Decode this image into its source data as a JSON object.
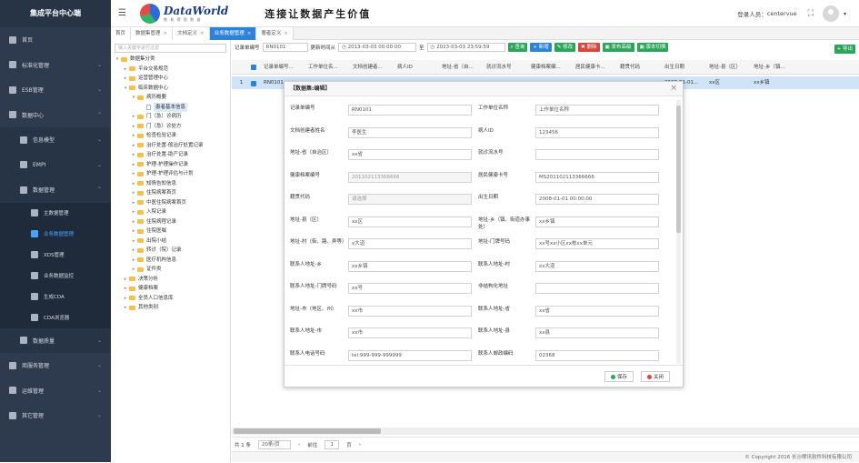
{
  "sidebar": {
    "brand": "集成平台中心端",
    "items": [
      {
        "label": "首页"
      },
      {
        "label": "标准化管理"
      },
      {
        "label": "ESB管理"
      },
      {
        "label": "数据中心"
      },
      {
        "label": "信息模型"
      },
      {
        "label": "EMPI"
      },
      {
        "label": "数据管理"
      },
      {
        "label": "主数据管理"
      },
      {
        "label": "业务数据管理"
      },
      {
        "label": "XDS管理"
      },
      {
        "label": "业务数据监控"
      },
      {
        "label": "生成CDA"
      },
      {
        "label": "CDA浏览器"
      },
      {
        "label": "数据质量"
      },
      {
        "label": "商服务管理"
      },
      {
        "label": "运维管理"
      },
      {
        "label": "其它管理"
      }
    ]
  },
  "header": {
    "logo_text": "DataWorld",
    "logo_sub": "数 易 得 智 数 据",
    "slogan": "连接让数据产生价值",
    "login_label": "登录人员：",
    "user": "centervue"
  },
  "tabs": [
    {
      "label": "首页"
    },
    {
      "label": "数据集管理"
    },
    {
      "label": "文档定义"
    },
    {
      "label": "业务数据管理"
    },
    {
      "label": "著者定义"
    }
  ],
  "tree": {
    "search_placeholder": "输入关键字进行过滤",
    "nodes": [
      {
        "label": "数据集分类",
        "level": 0,
        "toggle": "▾",
        "type": "folder"
      },
      {
        "label": "平台交易规范",
        "level": 1,
        "toggle": "▸",
        "type": "folder"
      },
      {
        "label": "运营管理中心",
        "level": 1,
        "toggle": "▸",
        "type": "folder"
      },
      {
        "label": "临床数据中心",
        "level": 1,
        "toggle": "▾",
        "type": "folder"
      },
      {
        "label": "病历概要",
        "level": 2,
        "toggle": "▾",
        "type": "folder"
      },
      {
        "label": "患者基本信息",
        "level": 3,
        "toggle": "",
        "type": "file"
      },
      {
        "label": "门（急）诊病历",
        "level": 2,
        "toggle": "▸",
        "type": "folder"
      },
      {
        "label": "门（急）诊处方",
        "level": 2,
        "toggle": "▸",
        "type": "folder"
      },
      {
        "label": "检查检验记录",
        "level": 2,
        "toggle": "▸",
        "type": "folder"
      },
      {
        "label": "治疗处置-般治疗处置记录",
        "level": 2,
        "toggle": "▸",
        "type": "folder"
      },
      {
        "label": "治疗处置-助产记录",
        "level": 2,
        "toggle": "▸",
        "type": "folder"
      },
      {
        "label": "护理-护理操作记录",
        "level": 2,
        "toggle": "▸",
        "type": "folder"
      },
      {
        "label": "护理-护理评估与计划",
        "level": 2,
        "toggle": "▸",
        "type": "folder"
      },
      {
        "label": "知情告知信息",
        "level": 2,
        "toggle": "▸",
        "type": "folder"
      },
      {
        "label": "住院病案首页",
        "level": 2,
        "toggle": "▸",
        "type": "folder"
      },
      {
        "label": "中医住院病案首页",
        "level": 2,
        "toggle": "▸",
        "type": "folder"
      },
      {
        "label": "入院记录",
        "level": 2,
        "toggle": "▸",
        "type": "folder"
      },
      {
        "label": "住院病程记录",
        "level": 2,
        "toggle": "▸",
        "type": "folder"
      },
      {
        "label": "住院医嘱",
        "level": 2,
        "toggle": "▸",
        "type": "folder"
      },
      {
        "label": "出院小结",
        "level": 2,
        "toggle": "▸",
        "type": "folder"
      },
      {
        "label": "转诊（院）记录",
        "level": 2,
        "toggle": "▸",
        "type": "folder"
      },
      {
        "label": "医疗机构信息",
        "level": 2,
        "toggle": "▸",
        "type": "folder"
      },
      {
        "label": "证件类",
        "level": 2,
        "toggle": "▸",
        "type": "folder"
      },
      {
        "label": "决策分析",
        "level": 1,
        "toggle": "▸",
        "type": "folder"
      },
      {
        "label": "健康档案",
        "level": 1,
        "toggle": "▸",
        "type": "folder"
      },
      {
        "label": "全员人口信息库",
        "level": 1,
        "toggle": "▸",
        "type": "folder"
      },
      {
        "label": "其他类别",
        "level": 1,
        "toggle": "▸",
        "type": "folder"
      }
    ]
  },
  "toolbar": {
    "record_label": "记录单编号",
    "record_value": "RN0101",
    "time_label": "更新时间从",
    "date_from": "2013-03-03 00:00:00",
    "to_label": "至",
    "date_to": "2023-03-03 23:59:59",
    "query": "查询",
    "add": "新增",
    "edit": "修改",
    "delete": "删除",
    "publish": "发布高级",
    "version": "版本切换",
    "export": "导出"
  },
  "grid": {
    "headers": [
      "记录单编号...",
      "工作单位名...",
      "文档创建者...",
      "病人ID",
      "地址-省（自...",
      "就诊流水号",
      "健康档案编...",
      "居民健康卡...",
      "籍贯代码",
      "出生日期",
      "地址-县（区）",
      "地址-乡（镇..."
    ],
    "row": {
      "num": "1",
      "cells": [
        "RN0101",
        "",
        "",
        "",
        "",
        "",
        "",
        "",
        "",
        "2008-01-01...",
        "xx区",
        "xx乡镇"
      ]
    }
  },
  "pager": {
    "total": "共 1 条",
    "per_page": "20条/页",
    "prev": "前往",
    "page": "1",
    "page_suffix": "页"
  },
  "footer": "© Copyright 2016 长沙摩讯软件科技有限公司",
  "dialog": {
    "title": "【数据集:编辑】",
    "fields": [
      {
        "l1": "记录单编号",
        "v1": "RN0101",
        "d1": false,
        "l2": "工作单位名称",
        "v2": "上作单位名称",
        "d2": false
      },
      {
        "l1": "文档创建者姓名",
        "v1": "李医生",
        "d1": false,
        "l2": "病人ID",
        "v2": "123456",
        "d2": false
      },
      {
        "l1": "地址-省（自治区）",
        "v1": "xx省",
        "d1": false,
        "l2": "就诊流水号",
        "v2": "",
        "d2": false
      },
      {
        "l1": "健康档案编号",
        "v1": "201102113366666",
        "d1": true,
        "l2": "居民健康卡号",
        "v2": "MS201102113366666",
        "d2": false
      },
      {
        "l1": "籍贯代码",
        "v1": "请选择",
        "d1": true,
        "l2": "出生日期",
        "v2": "2008-01-01 00:00:00",
        "d2": false
      },
      {
        "l1": "地址-县（区）",
        "v1": "xx区",
        "d1": false,
        "l2": "地址-乡（镇、街道办事处）",
        "v2": "xx乡镇",
        "d2": false
      },
      {
        "l1": "地址-村（街、路、弄等）",
        "v1": "x大道",
        "d1": false,
        "l2": "地址-门牌号码",
        "v2": "xx号xx小区xx栋xx单元",
        "d2": false
      },
      {
        "l1": "联系人地址-乡",
        "v1": "xx乡镇",
        "d1": false,
        "l2": "联系人地址-村",
        "v2": "xx大道",
        "d2": false
      },
      {
        "l1": "联系人地址-门牌号码",
        "v1": "xx号",
        "d1": false,
        "l2": "非结构化地址",
        "v2": "",
        "d2": false
      },
      {
        "l1": "地址-市（地区、州）",
        "v1": "xx市",
        "d1": false,
        "l2": "联系人地址-省",
        "v2": "xx省",
        "d2": false
      },
      {
        "l1": "联系人地址-市",
        "v1": "xx市",
        "d1": false,
        "l2": "联系人地址-县",
        "v2": "xx县",
        "d2": false
      },
      {
        "l1": "联系人电话号码",
        "v1": "tel:999-999-999999",
        "d1": false,
        "l2": "联系人邮政编码",
        "v2": "02368",
        "d2": false
      }
    ],
    "save": "保存",
    "close": "关闭"
  },
  "colors": {
    "sidebar": "#2e3b4e",
    "accent": "#2c83d9",
    "green": "#2aa55a",
    "red": "#d9463e"
  }
}
